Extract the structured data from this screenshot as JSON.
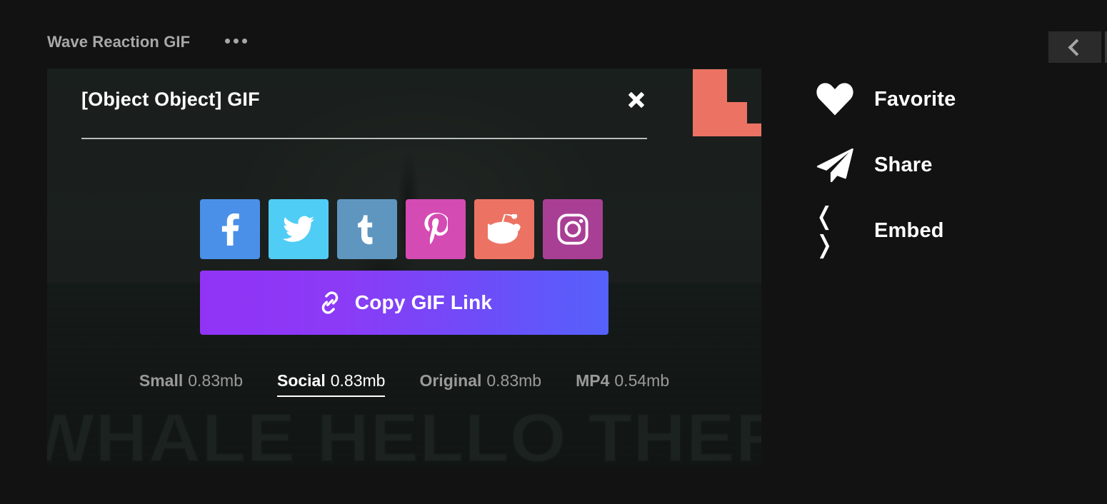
{
  "page": {
    "background_color": "#121212",
    "gif_title": "Wave Reaction GIF",
    "more_menu_label": "•••"
  },
  "nav": {
    "prev_label": "‹",
    "prev_icon": "chevron-left-icon",
    "next_icon": "chevron-right-icon"
  },
  "modal": {
    "title": "[Object Object] GIF",
    "close_label": "✕",
    "background_meme_text": "WHALE HELLO THERE",
    "social_buttons": [
      {
        "id": "facebook",
        "label": "Facebook",
        "color": "#4a90e8"
      },
      {
        "id": "twitter",
        "label": "Twitter",
        "color": "#50cdf5"
      },
      {
        "id": "tumblr",
        "label": "Tumblr",
        "color": "#5e96bf"
      },
      {
        "id": "pinterest",
        "label": "Pinterest",
        "color": "#d44bb4"
      },
      {
        "id": "reddit",
        "label": "Reddit",
        "color": "#ec7363"
      },
      {
        "id": "instagram",
        "label": "Instagram",
        "color": "#a93f94"
      }
    ],
    "copy_button": {
      "label": "Copy GIF Link",
      "icon": "link-icon",
      "gradient_start": "#9133f5",
      "gradient_end": "#5561fb"
    },
    "size_options": [
      {
        "name": "Small",
        "size": "0.83mb",
        "active": false
      },
      {
        "name": "Social",
        "size": "0.83mb",
        "active": true
      },
      {
        "name": "Original",
        "size": "0.83mb",
        "active": false
      },
      {
        "name": "MP4",
        "size": "0.54mb",
        "active": false
      }
    ],
    "decoration_color": "#ec7363"
  },
  "actions": [
    {
      "label": "Favorite",
      "icon": "heart-icon"
    },
    {
      "label": "Share",
      "icon": "paper-plane-icon"
    },
    {
      "label": "Embed",
      "icon": "code-brackets-icon",
      "glyph": "❬ ❭"
    }
  ]
}
